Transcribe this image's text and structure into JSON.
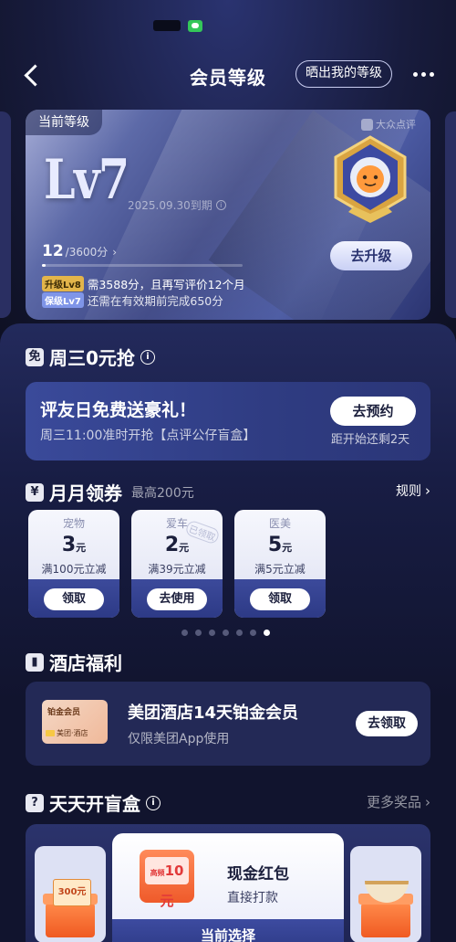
{
  "nav": {
    "title": "会员等级",
    "share_label": "晒出我的等级"
  },
  "level_card": {
    "current_label": "当前等级",
    "brand": "大众点评",
    "level": "Lv7",
    "expiry": "2025.09.30到期",
    "points": "12",
    "points_total": "/3600分",
    "progress_fraction": 0.003,
    "upgrade_tag": "升级Lv8",
    "upgrade_text": "需3588分，且再写评价12个月",
    "keep_tag": "保级Lv7",
    "keep_text": "还需在有效期前完成650分",
    "upgrade_button": "去升级"
  },
  "wednesday": {
    "icon": "免",
    "title": "周三0元抢",
    "main": "评友日免费送豪礼！",
    "sub": "周三11:00准时开抢【点评公仔盲盒】",
    "button": "去预约",
    "countdown": "距开始还剩2天"
  },
  "coupons_section": {
    "icon": "¥",
    "title": "月月领券",
    "subtitle": "最高200元",
    "rules": "规则",
    "items": [
      {
        "category": "宠物",
        "amount": "3",
        "unit": "元",
        "condition": "满100元立减",
        "button": "领取",
        "stamp": ""
      },
      {
        "category": "爱车",
        "amount": "2",
        "unit": "元",
        "condition": "满39元立减",
        "button": "去使用",
        "stamp": "已领取"
      },
      {
        "category": "医美",
        "amount": "5",
        "unit": "元",
        "condition": "满5元立减",
        "button": "领取",
        "stamp": ""
      }
    ],
    "dots_total": 7,
    "dots_active": 6
  },
  "hotel": {
    "title": "酒店福利",
    "thumb_title": "铂金会员",
    "thumb_brand": "美团·酒店",
    "main": "美团酒店14天铂金会员",
    "sub": "仅限美团App使用",
    "button": "去领取"
  },
  "blind_box": {
    "title": "天天开盲盒",
    "more": "更多奖品",
    "left_prize_label": "300元",
    "center_coupon": "10元",
    "center_coupon_tag": "高频",
    "center_main": "现金红包",
    "center_sub": "直接打款",
    "current": "当前选择"
  },
  "colors": {
    "background": "#0e1022",
    "accent_gold": "#e3b54a",
    "accent_blue": "#7f95e8"
  }
}
